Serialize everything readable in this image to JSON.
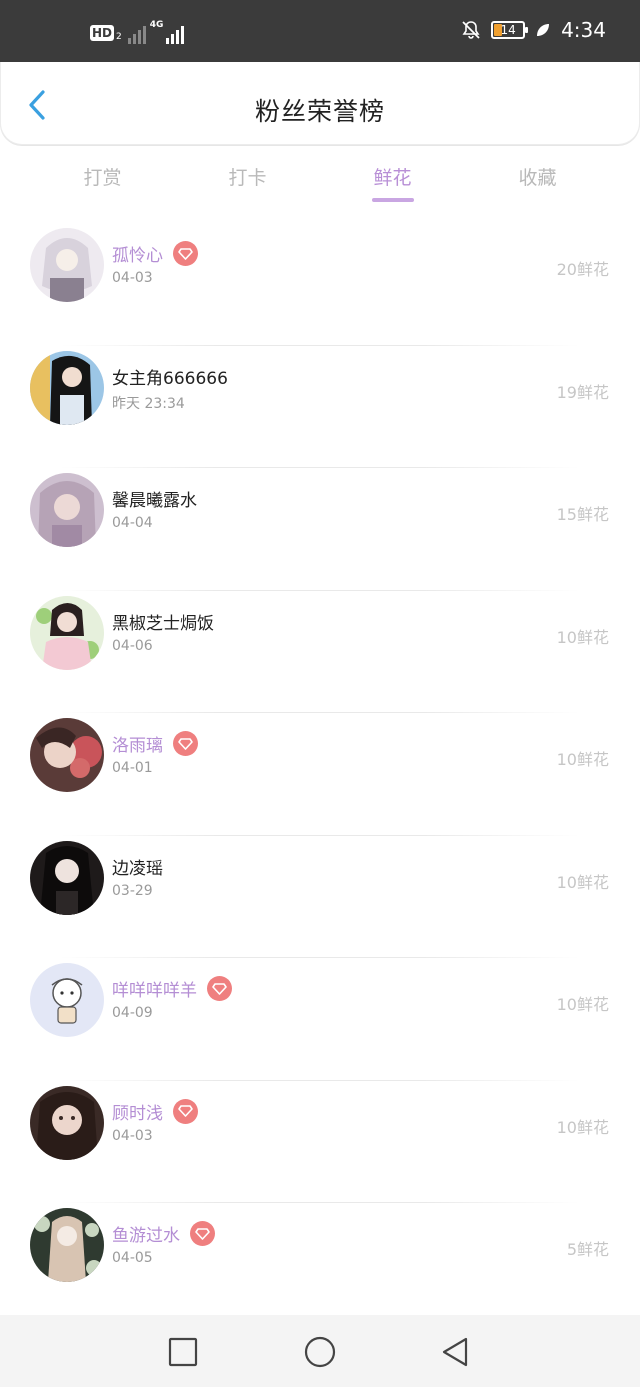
{
  "status_bar": {
    "hd_label": "HD",
    "hd_sub": "2",
    "net_label": "4G",
    "battery": "14",
    "time": "4:34"
  },
  "header": {
    "title": "粉丝荣誉榜"
  },
  "tabs": [
    {
      "label": "打赏",
      "active": false
    },
    {
      "label": "打卡",
      "active": false
    },
    {
      "label": "鲜花",
      "active": true
    },
    {
      "label": "收藏",
      "active": false
    }
  ],
  "rows": [
    {
      "name": "孤怜心",
      "date": "04-03",
      "count": "20鲜花",
      "vip": true
    },
    {
      "name": "女主角666666",
      "date": "昨天 23:34",
      "count": "19鲜花",
      "vip": false
    },
    {
      "name": "馨晨曦露水",
      "date": "04-04",
      "count": "15鲜花",
      "vip": false
    },
    {
      "name": "黑椒芝士焗饭",
      "date": "04-06",
      "count": "10鲜花",
      "vip": false
    },
    {
      "name": "洛雨璃",
      "date": "04-01",
      "count": "10鲜花",
      "vip": true
    },
    {
      "name": "边凌瑶",
      "date": "03-29",
      "count": "10鲜花",
      "vip": false
    },
    {
      "name": "咩咩咩咩羊",
      "date": "04-09",
      "count": "10鲜花",
      "vip": true
    },
    {
      "name": "顾时浅",
      "date": "04-03",
      "count": "10鲜花",
      "vip": true
    },
    {
      "name": "鱼游过水",
      "date": "04-05",
      "count": "5鲜花",
      "vip": true
    }
  ],
  "icons": {
    "back": "chevron-left-icon",
    "vip": "diamond-icon",
    "nav_recent": "square-icon",
    "nav_home": "circle-icon",
    "nav_back": "triangle-back-icon"
  },
  "colors": {
    "accent": "#b88fd6",
    "vip_badge": "#ef7f7f",
    "back_arrow": "#3aa0e0",
    "status_bar": "#3b3b3b"
  }
}
